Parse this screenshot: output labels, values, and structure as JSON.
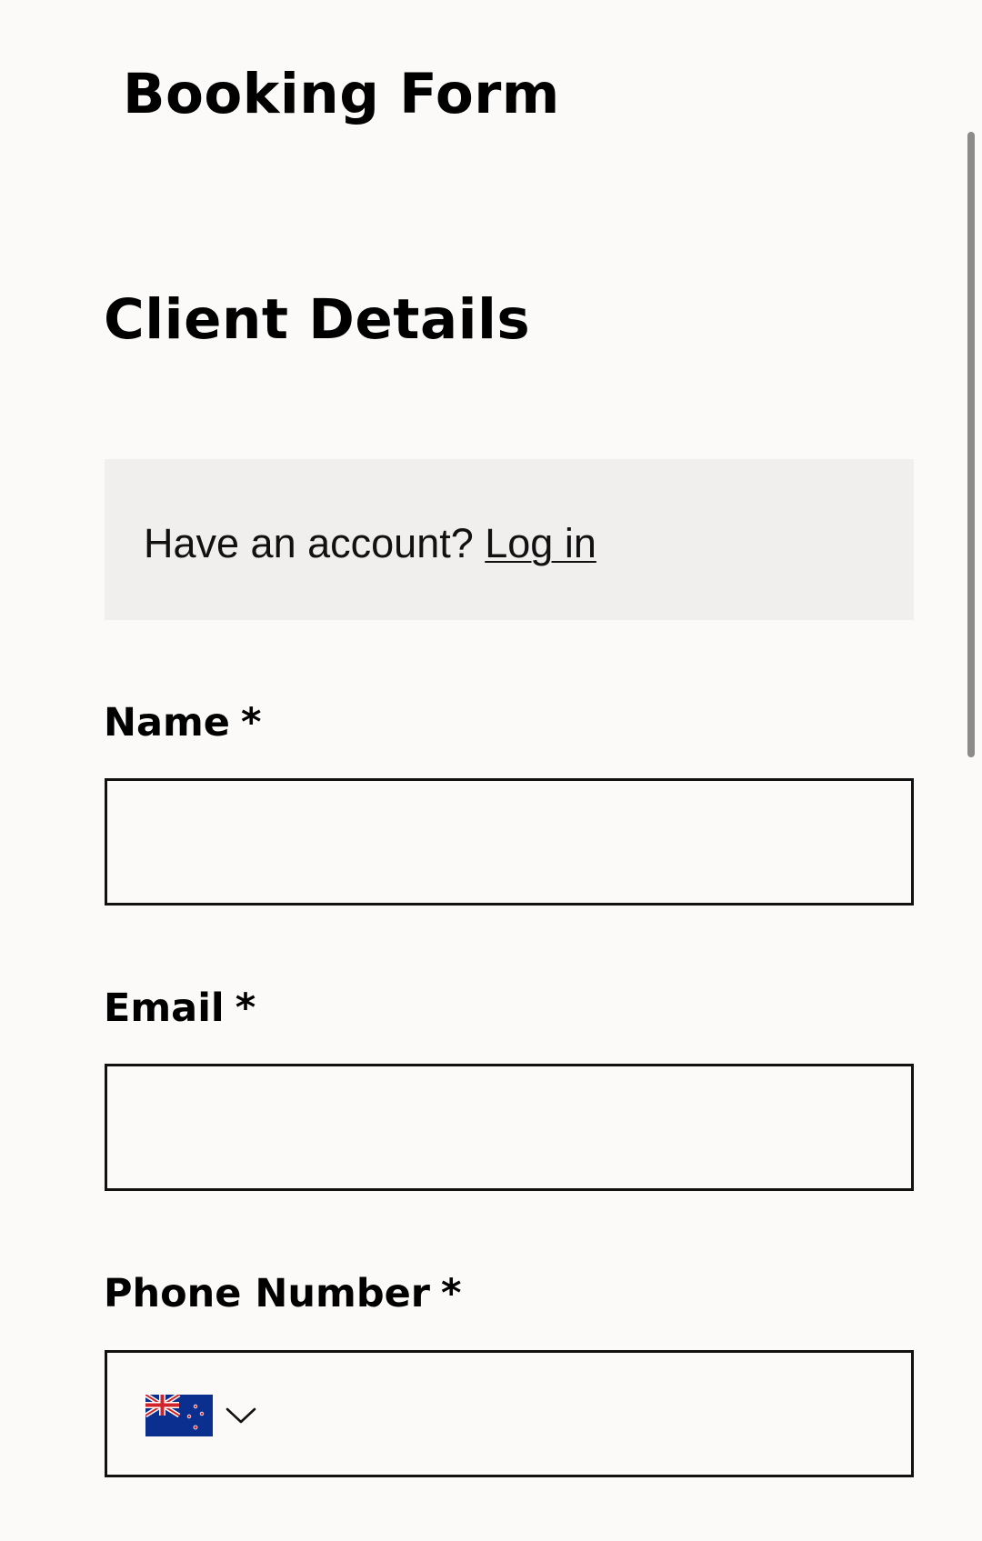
{
  "header": {
    "title": "Booking Form"
  },
  "section": {
    "title": "Client Details"
  },
  "login_prompt": {
    "text": "Have an account? ",
    "link_label": "Log in"
  },
  "fields": {
    "name": {
      "label": "Name",
      "required_mark": "*",
      "value": ""
    },
    "email": {
      "label": "Email",
      "required_mark": "*",
      "value": ""
    },
    "phone": {
      "label": "Phone Number",
      "required_mark": "*",
      "value": "",
      "country_flag": "new-zealand-flag-icon"
    }
  },
  "colors": {
    "background": "#fbfaf8",
    "login_box": "#f0efee",
    "text": "#000000",
    "border": "#111111",
    "scrollbar": "#8b8b8b"
  }
}
